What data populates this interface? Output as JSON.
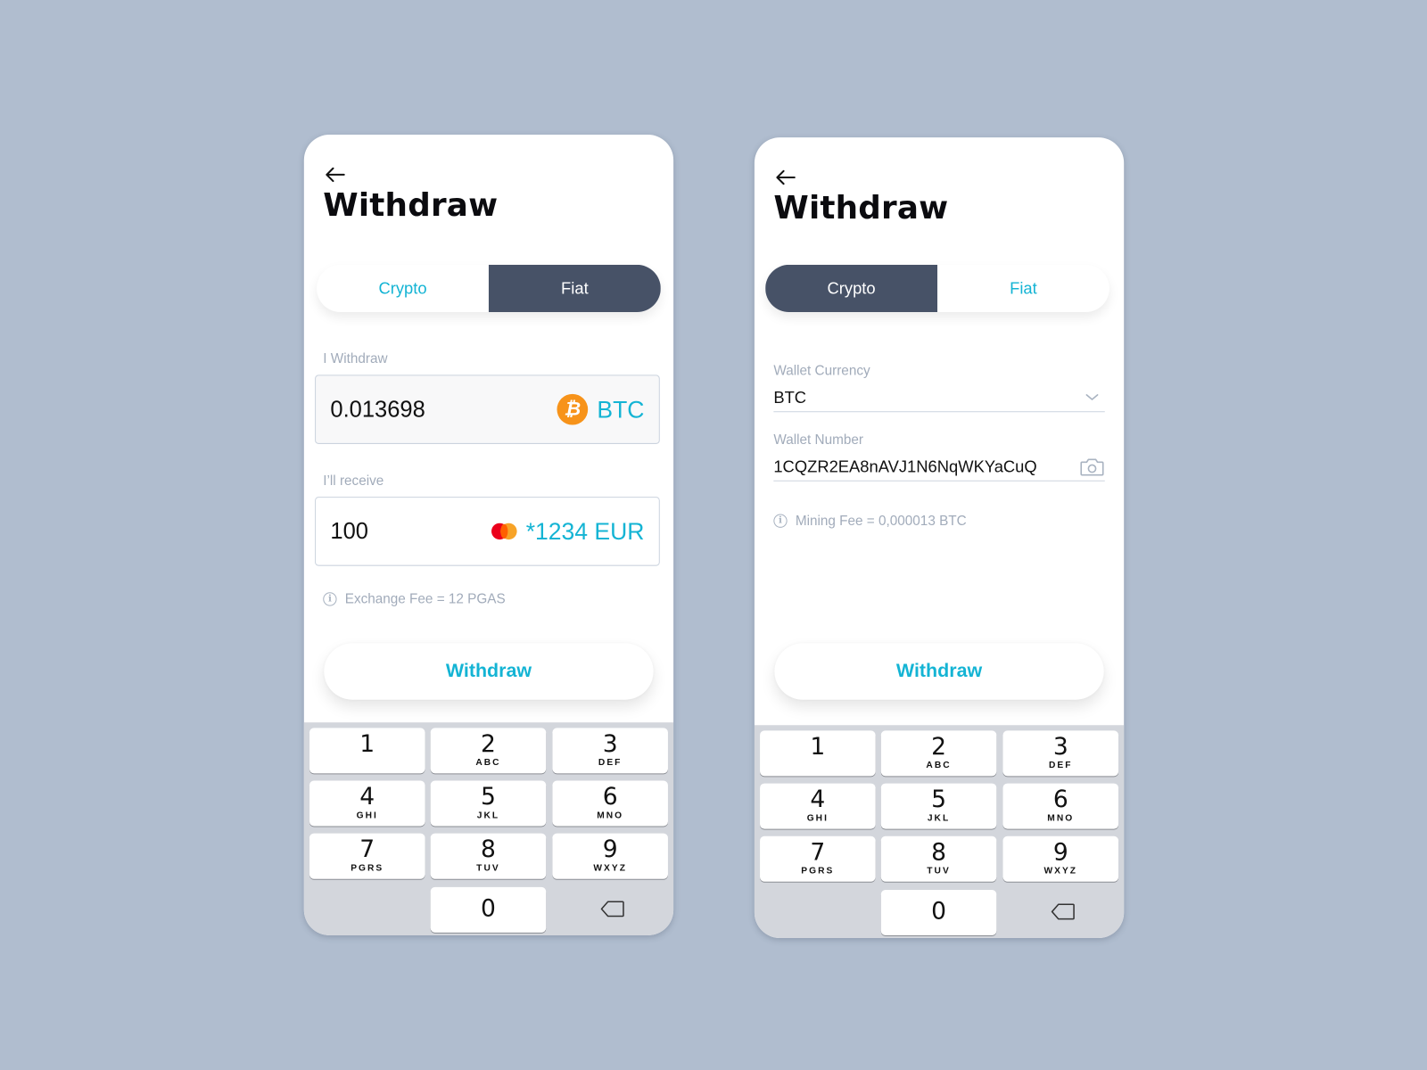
{
  "screens": [
    {
      "title": "Withdraw",
      "tabs": [
        {
          "label": "Crypto",
          "active": false
        },
        {
          "label": "Fiat",
          "active": true
        }
      ],
      "withdraw_field": {
        "label": "I Withdraw",
        "value": "0.013698",
        "currency": "BTC",
        "currency_icon": "bitcoin-icon"
      },
      "receive_field": {
        "label": "I’ll receive",
        "value": "100",
        "currency": "*1234 EUR",
        "currency_icon": "mastercard-icon"
      },
      "fee_text": "Exchange Fee = 12 PGAS",
      "button_label": "Withdraw"
    },
    {
      "title": "Withdraw",
      "tabs": [
        {
          "label": "Crypto",
          "active": true
        },
        {
          "label": "Fiat",
          "active": false
        }
      ],
      "wallet_currency": {
        "label": "Wallet Currency",
        "value": "BTC"
      },
      "wallet_number": {
        "label": "Wallet Number",
        "value": "1CQZR2EA8nAVJ1N6NqWKYaCuQ"
      },
      "fee_text": "Mining Fee = 0,000013 BTC",
      "button_label": "Withdraw"
    }
  ],
  "keypad": {
    "keys": [
      {
        "num": "1",
        "letters": ""
      },
      {
        "num": "2",
        "letters": "ABC"
      },
      {
        "num": "3",
        "letters": "DEF"
      },
      {
        "num": "4",
        "letters": "GHI"
      },
      {
        "num": "5",
        "letters": "JKL"
      },
      {
        "num": "6",
        "letters": "MNO"
      },
      {
        "num": "7",
        "letters": "PGRS"
      },
      {
        "num": "8",
        "letters": "TUV"
      },
      {
        "num": "9",
        "letters": "WXYZ"
      },
      {
        "num": "0",
        "letters": ""
      }
    ]
  },
  "colors": {
    "background": "#b0bdcf",
    "accent": "#14b4d4",
    "active_tab": "#475267",
    "bitcoin": "#f7931a",
    "label_gray": "#a1abba"
  }
}
